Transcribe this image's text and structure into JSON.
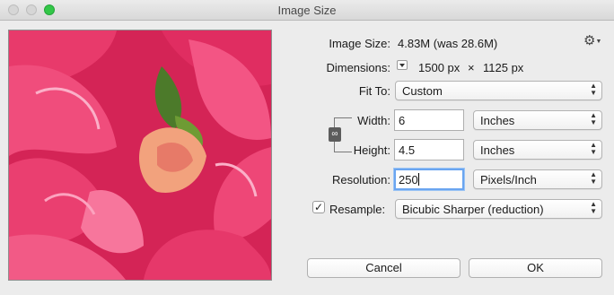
{
  "window": {
    "title": "Image Size"
  },
  "colors": {
    "zoom_button": "#33c748",
    "focus_ring": "#6aa5f0"
  },
  "summary": {
    "image_size_label": "Image Size:",
    "image_size_value": "4.83M (was 28.6M)",
    "dimensions_label": "Dimensions:",
    "dimensions_width": "1500 px",
    "dimensions_times": "×",
    "dimensions_height": "1125 px"
  },
  "icons": {
    "gear": "gear-icon",
    "link": "chain-link-icon",
    "popup_arrows": "up-down-arrows-icon"
  },
  "fit_to": {
    "label": "Fit To:",
    "value": "Custom"
  },
  "width": {
    "label": "Width:",
    "value": "6",
    "unit": "Inches"
  },
  "height": {
    "label": "Height:",
    "value": "4.5",
    "unit": "Inches"
  },
  "resolution": {
    "label": "Resolution:",
    "value": "250",
    "unit": "Pixels/Inch"
  },
  "resample": {
    "label": "Resample:",
    "checked": true,
    "value": "Bicubic Sharper (reduction)"
  },
  "buttons": {
    "cancel": "Cancel",
    "ok": "OK"
  }
}
